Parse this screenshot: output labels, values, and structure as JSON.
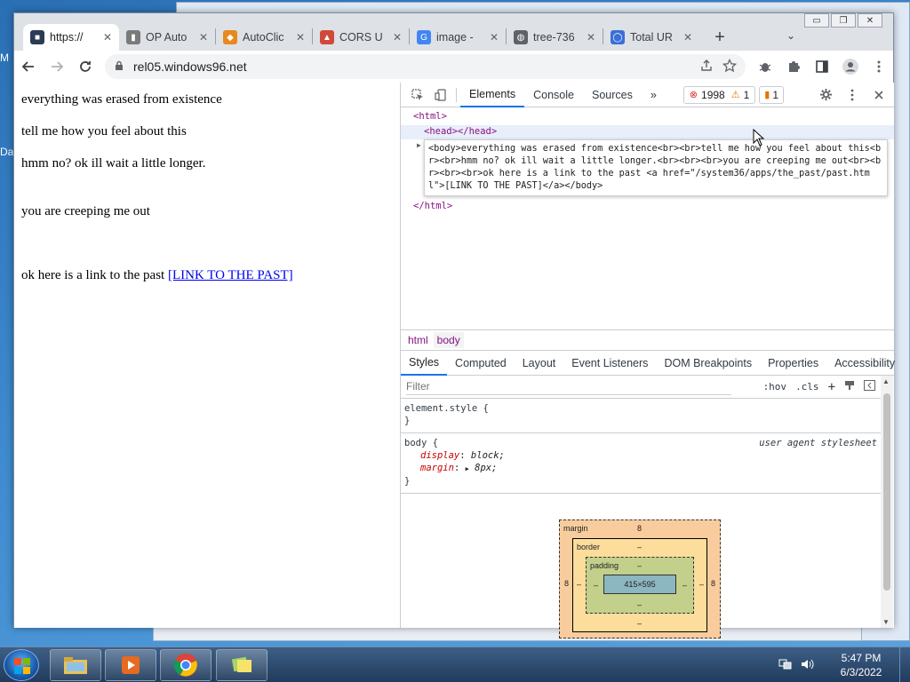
{
  "desktop": {
    "label_m": "M",
    "label_d": "Da"
  },
  "window": {
    "minimize": "▭",
    "restore": "❐",
    "close": "✕"
  },
  "tabs": [
    {
      "title": "https://",
      "favicon_color": "#2b3a55",
      "favicon_glyph": "■",
      "active": true
    },
    {
      "title": "OP Auto",
      "favicon_color": "#7a7a7a",
      "favicon_glyph": "▮"
    },
    {
      "title": "AutoClic",
      "favicon_color": "#e8891c",
      "favicon_glyph": "◆"
    },
    {
      "title": "CORS U",
      "favicon_color": "#d04a3a",
      "favicon_glyph": "▲"
    },
    {
      "title": "image -",
      "favicon_color": "#4285f4",
      "favicon_glyph": "G"
    },
    {
      "title": "tree-736",
      "favicon_color": "#5f6368",
      "favicon_glyph": "◍"
    },
    {
      "title": "Total UR",
      "favicon_color": "#3b6fd8",
      "favicon_glyph": "◯"
    }
  ],
  "tab_close": "✕",
  "newtab": "+",
  "tab_menu": "⌄",
  "omnibox": {
    "url": "rel05.windows96.net",
    "lock_icon": "🔒"
  },
  "page": {
    "lines": [
      "everything was erased from existence",
      "tell me how you feel about this",
      "hmm no? ok ill wait a little longer.",
      "you are creeping me out",
      "ok here is a link to the past "
    ],
    "link_text": "[LINK TO THE PAST]"
  },
  "devtools": {
    "tabs": [
      "Elements",
      "Console",
      "Sources"
    ],
    "more": "»",
    "error_count": "1998",
    "warning_count": "1",
    "issue_count": "1",
    "dom": {
      "html_open": "<html>",
      "head": "<head></head>",
      "html_close": "</html>",
      "body_tooltip": "<body>everything was erased from existence<br><br>tell me how you feel about this<br><br>hmm no? ok ill wait a little longer.<br><br><br>you are creeping me out<br><br><br><br>ok here is a link to the past <a href=\"/system36/apps/the_past/past.html\">[LINK TO THE PAST]</a></body>"
    },
    "breadcrumbs": [
      "html",
      "body"
    ],
    "style_tabs": [
      "Styles",
      "Computed",
      "Layout",
      "Event Listeners",
      "DOM Breakpoints",
      "Properties",
      "Accessibility"
    ],
    "filter_placeholder": "Filter",
    "hov": ":hov",
    "cls": ".cls",
    "rules": {
      "element_style": "element.style {",
      "close_brace": "}",
      "body_selector": "body {",
      "ua_source": "user agent stylesheet",
      "display_name": "display",
      "display_value": "block;",
      "margin_name": "margin",
      "margin_value": "8px;"
    },
    "box_model": {
      "margin_label": "margin",
      "margin_top": "8",
      "margin_left": "8",
      "margin_right": "8",
      "margin_bottom": "–",
      "border_label": "border",
      "border_value": "–",
      "padding_label": "padding",
      "padding_value": "–",
      "content": "415×595"
    }
  },
  "clock": {
    "time": "5:47 PM",
    "date": "6/3/2022"
  }
}
